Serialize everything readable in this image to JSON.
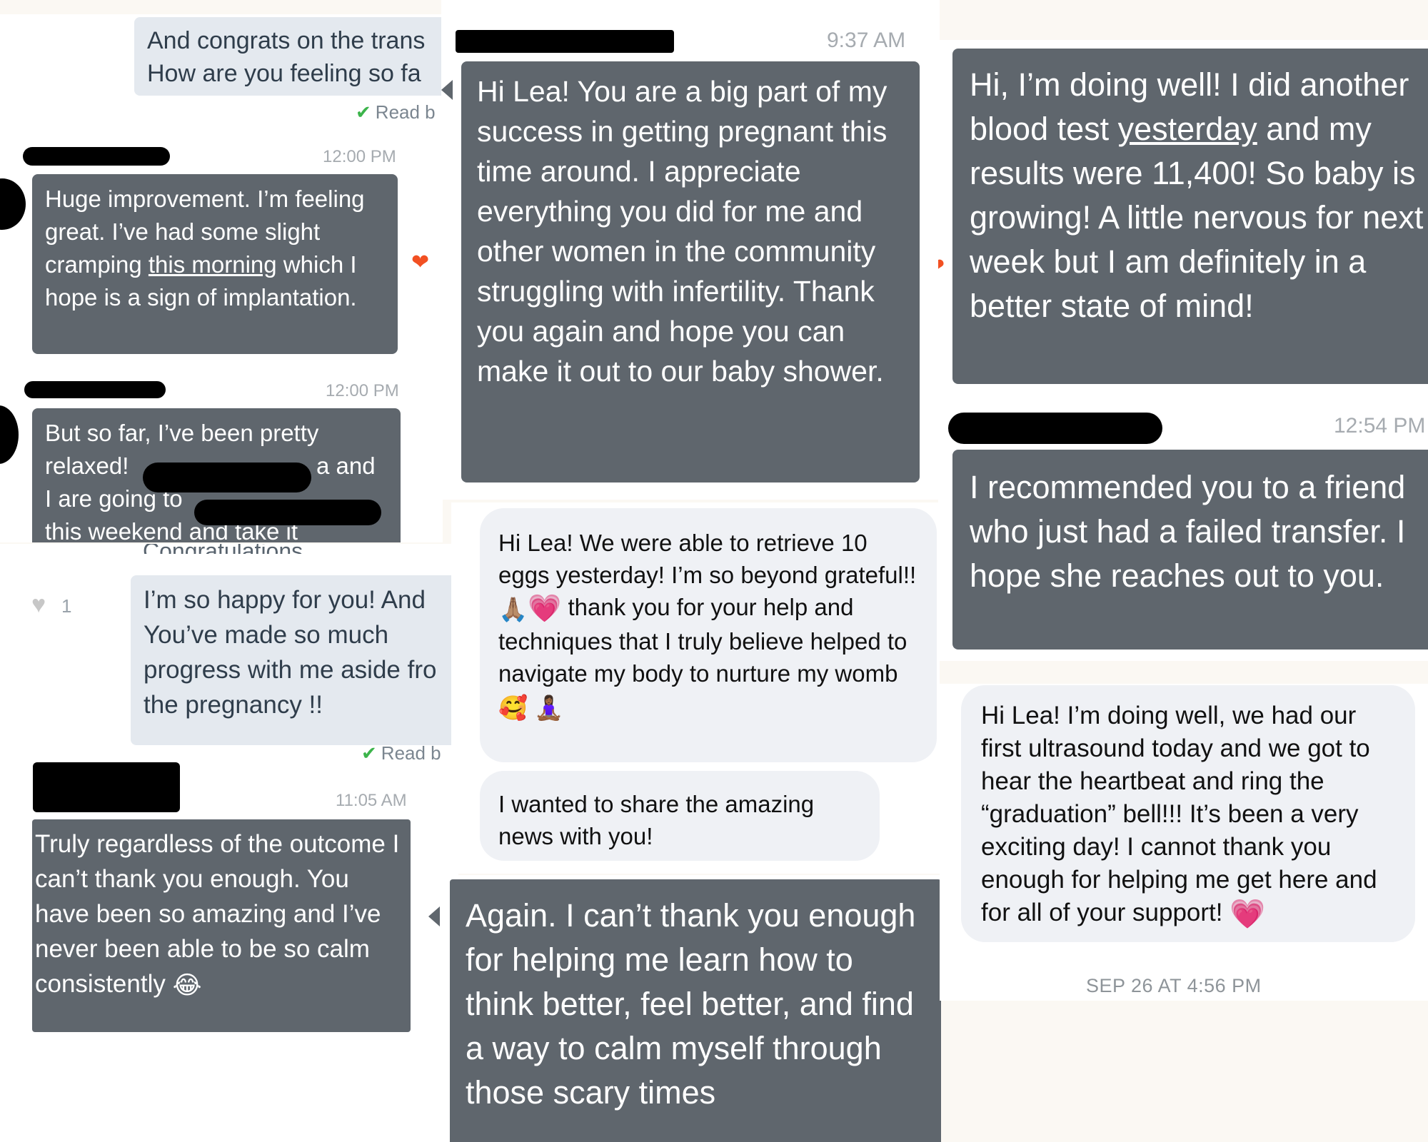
{
  "panel1": {
    "sent_top": {
      "line1": "And congrats on the trans",
      "line2": "How are you feeling so fa"
    },
    "read_label": "Read b",
    "msg1_time": "12:00 PM",
    "msg1": {
      "pre": "Huge improvement. I’m feeling great. I’ve had some slight cramping ",
      "link": "this morning",
      "post": " which I hope is a sign of implantation."
    },
    "msg2_time": "12:00 PM",
    "msg2": {
      "l1": "But so far, I’ve been pretty",
      "l2a": "relaxed!",
      "l2b": "a and",
      "l3": "I are going to",
      "l4": "this weekend and take it"
    }
  },
  "panel2": {
    "time": "9:37 AM",
    "text": "Hi Lea! You are a big part of my success in getting pregnant this time around. I appreciate everything you did for me and other women in the community struggling with infertility. Thank you again and hope you can make it out to our baby shower."
  },
  "panel3": {
    "msg1": {
      "pre": "Hi, I’m doing well! I did another blood test ",
      "link": "yesterday",
      "post": " and my results were 11,400! So baby is growing! A little nervous for next week but I am definitely in a better state of mind!"
    },
    "time": "12:54 PM",
    "msg2": "I recommended you to a friend who just had a failed transfer. I hope she reaches out to you."
  },
  "panel4": {
    "like_count": "1",
    "cut_text": "Congratulations ...",
    "sent_lines": [
      "I’m so happy for you! And",
      "You’ve made so much",
      "progress with me aside fro",
      "the pregnancy !!"
    ],
    "read_label": "Read b",
    "time": "11:05 AM",
    "msg": "Truly regardless of the outcome I can’t thank you enough. You have been so amazing and I’ve never been able to be so calm consistently",
    "msg_emoji": "😂"
  },
  "panel5": {
    "msg1_text": "Hi Lea! We were able to retrieve 10 eggs yesterday! I’m so beyond grateful!!",
    "emoji_pray": "🙏🏽",
    "emoji_heart": "💗",
    "msg1_text2": "thank you for your help and techniques that I truly believe helped to navigate my body to nurture my womb",
    "emoji_smile": "🥰",
    "emoji_yoga": "🧘🏾‍♀️",
    "msg2": "I wanted to share the amazing news with you!"
  },
  "panel6": {
    "text": "Again. I can’t thank you enough for helping me learn how to think better, feel better, and find a way to calm myself through those scary times"
  },
  "panel7": {
    "text": "Hi Lea! I’m doing well, we had our first ultrasound today and we got to hear the heartbeat and ring the “graduation” bell!!! It’s been a very exciting day! I cannot thank you enough for helping me get here and for all of your support!",
    "emoji_heart": "💗",
    "timestamp": "SEP 26 AT 4:56 PM"
  },
  "icons": {
    "heart": "heart-icon",
    "check": "checkmark-icon"
  },
  "colors": {
    "dark_bubble": "#5f666d",
    "sent_bubble": "#e4e9ef",
    "light_bubble": "#eff1f5",
    "heart": "#f25022",
    "check": "#3cb44b"
  }
}
